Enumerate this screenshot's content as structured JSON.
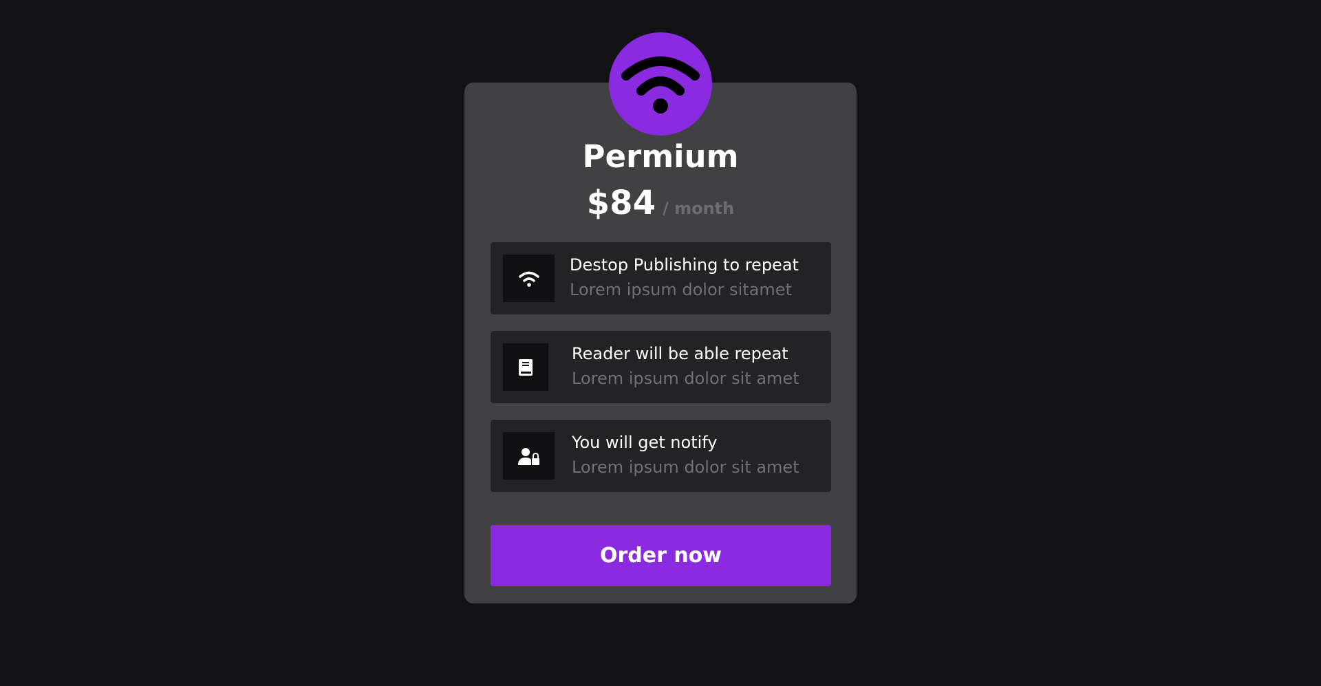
{
  "plan": {
    "name": "Permium",
    "price": "$84",
    "period": "/ month",
    "badge_icon": "wifi-icon"
  },
  "features": [
    {
      "icon": "wifi-icon",
      "title": "Destop Publishing to repeat",
      "subtitle": "Lorem ipsum dolor sitamet"
    },
    {
      "icon": "book-icon",
      "title": "Reader will be able repeat",
      "subtitle": "Lorem ipsum dolor sit amet"
    },
    {
      "icon": "user-lock-icon",
      "title": "You will get notify",
      "subtitle": "Lorem ipsum dolor sit amet"
    }
  ],
  "cta": {
    "label": "Order now"
  },
  "colors": {
    "background": "#131214",
    "card": "#414042",
    "feature_box": "#232224",
    "accent": "#8a2be2",
    "muted_text": "#727177"
  }
}
